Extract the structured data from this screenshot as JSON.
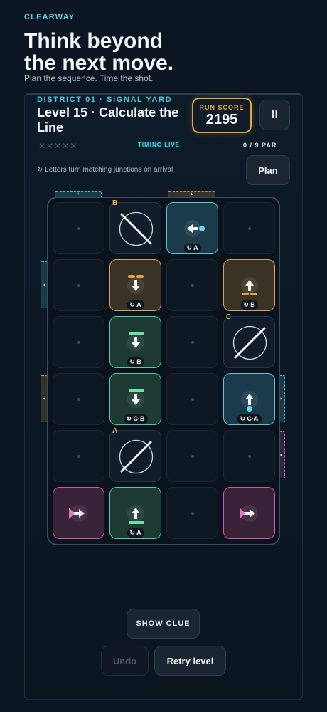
{
  "brand": "CLEARWAY",
  "headline": [
    "Think beyond",
    "the next move."
  ],
  "tagline": "Plan the sequence. Time the shot.",
  "header": {
    "district": "DISTRICT 01 · SIGNAL YARD",
    "level_title": "Level 15 · Calculate the Line",
    "score_label": "RUN SCORE",
    "score_value": "2195",
    "pause_label": "II"
  },
  "status": {
    "stars": "✕✕✕✕✕",
    "timing": "TIMING LIVE",
    "par": "0 / 9 PAR"
  },
  "hint": "↻ Letters turn matching junctions on arrival",
  "plan_label": "Plan",
  "colors": {
    "accent_cyan": "#5fd3e6",
    "accent_orange": "#e0a53c",
    "accent_green": "#58c99b",
    "accent_pink": "#c85ca8",
    "background": "#0b1622"
  },
  "board": {
    "rows": 6,
    "cols": 4,
    "tiles": [
      {
        "r": 0,
        "c": 1,
        "type": "mirror",
        "dir": "back",
        "letter": "B"
      },
      {
        "r": 0,
        "c": 2,
        "type": "cyan",
        "icon": "arrow-left-icon",
        "ring": "↻ A"
      },
      {
        "r": 1,
        "c": 1,
        "type": "orange",
        "icon": "arrow-down-icon",
        "ring": "↻ A"
      },
      {
        "r": 1,
        "c": 3,
        "type": "orange",
        "icon": "arrow-up-icon",
        "ring": "↻ B"
      },
      {
        "r": 2,
        "c": 1,
        "type": "green",
        "icon": "arrow-down-icon",
        "ring": "↻ B"
      },
      {
        "r": 2,
        "c": 3,
        "type": "mirror",
        "dir": "fwd",
        "letter": "C"
      },
      {
        "r": 3,
        "c": 1,
        "type": "green",
        "icon": "arrow-down-icon",
        "ring": "↻ C·B"
      },
      {
        "r": 3,
        "c": 3,
        "type": "cyan",
        "icon": "arrow-up-icon",
        "ring": "↻ C·A"
      },
      {
        "r": 4,
        "c": 1,
        "type": "mirror",
        "dir": "fwd",
        "letter": "A"
      },
      {
        "r": 5,
        "c": 0,
        "type": "pink",
        "icon": "arrow-right-icon"
      },
      {
        "r": 5,
        "c": 1,
        "type": "green",
        "icon": "arrow-up-icon",
        "ring": "↻ A"
      },
      {
        "r": 5,
        "c": 3,
        "type": "pink",
        "icon": "arrow-right-icon"
      }
    ]
  },
  "edge_arrows": {
    "top_left": "↑",
    "top_right": "▲",
    "left_1": "◂",
    "left_2": "◂",
    "right_1": "▸",
    "right_2": "▸"
  },
  "controls": {
    "clue_label": "SHOW CLUE",
    "undo_label": "Undo",
    "retry_label": "Retry level"
  }
}
